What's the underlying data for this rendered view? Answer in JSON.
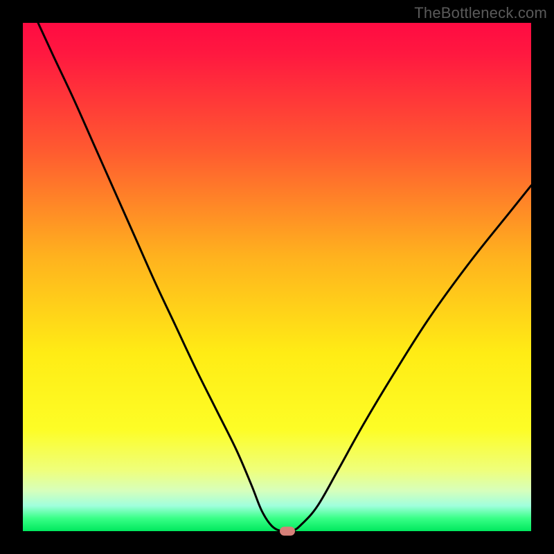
{
  "watermark": "TheBottleneck.com",
  "chart_data": {
    "type": "line",
    "title": "",
    "xlabel": "",
    "ylabel": "",
    "xlim": [
      0,
      100
    ],
    "ylim": [
      0,
      100
    ],
    "series": [
      {
        "name": "bottleneck-curve",
        "x": [
          3,
          6,
          10,
          14,
          18,
          22,
          26,
          30,
          34,
          38,
          42,
          45,
          47,
          49,
          51,
          53,
          55,
          58,
          62,
          67,
          73,
          80,
          88,
          96,
          100
        ],
        "values": [
          100,
          93.5,
          85,
          76,
          67,
          58,
          49,
          40.5,
          32,
          24,
          16,
          9,
          4,
          1,
          0,
          0,
          1.5,
          5,
          12,
          21,
          31,
          42,
          53,
          63,
          68
        ]
      }
    ],
    "marker": {
      "x": 52,
      "y": 0,
      "color": "#d68079"
    },
    "background_gradient": [
      {
        "pos": 0,
        "color": "#ff0b42"
      },
      {
        "pos": 25,
        "color": "#ff5a30"
      },
      {
        "pos": 46,
        "color": "#ffb21e"
      },
      {
        "pos": 65,
        "color": "#ffec15"
      },
      {
        "pos": 88,
        "color": "#efff7b"
      },
      {
        "pos": 95,
        "color": "#a0ffdd"
      },
      {
        "pos": 100,
        "color": "#00e85e"
      }
    ]
  }
}
